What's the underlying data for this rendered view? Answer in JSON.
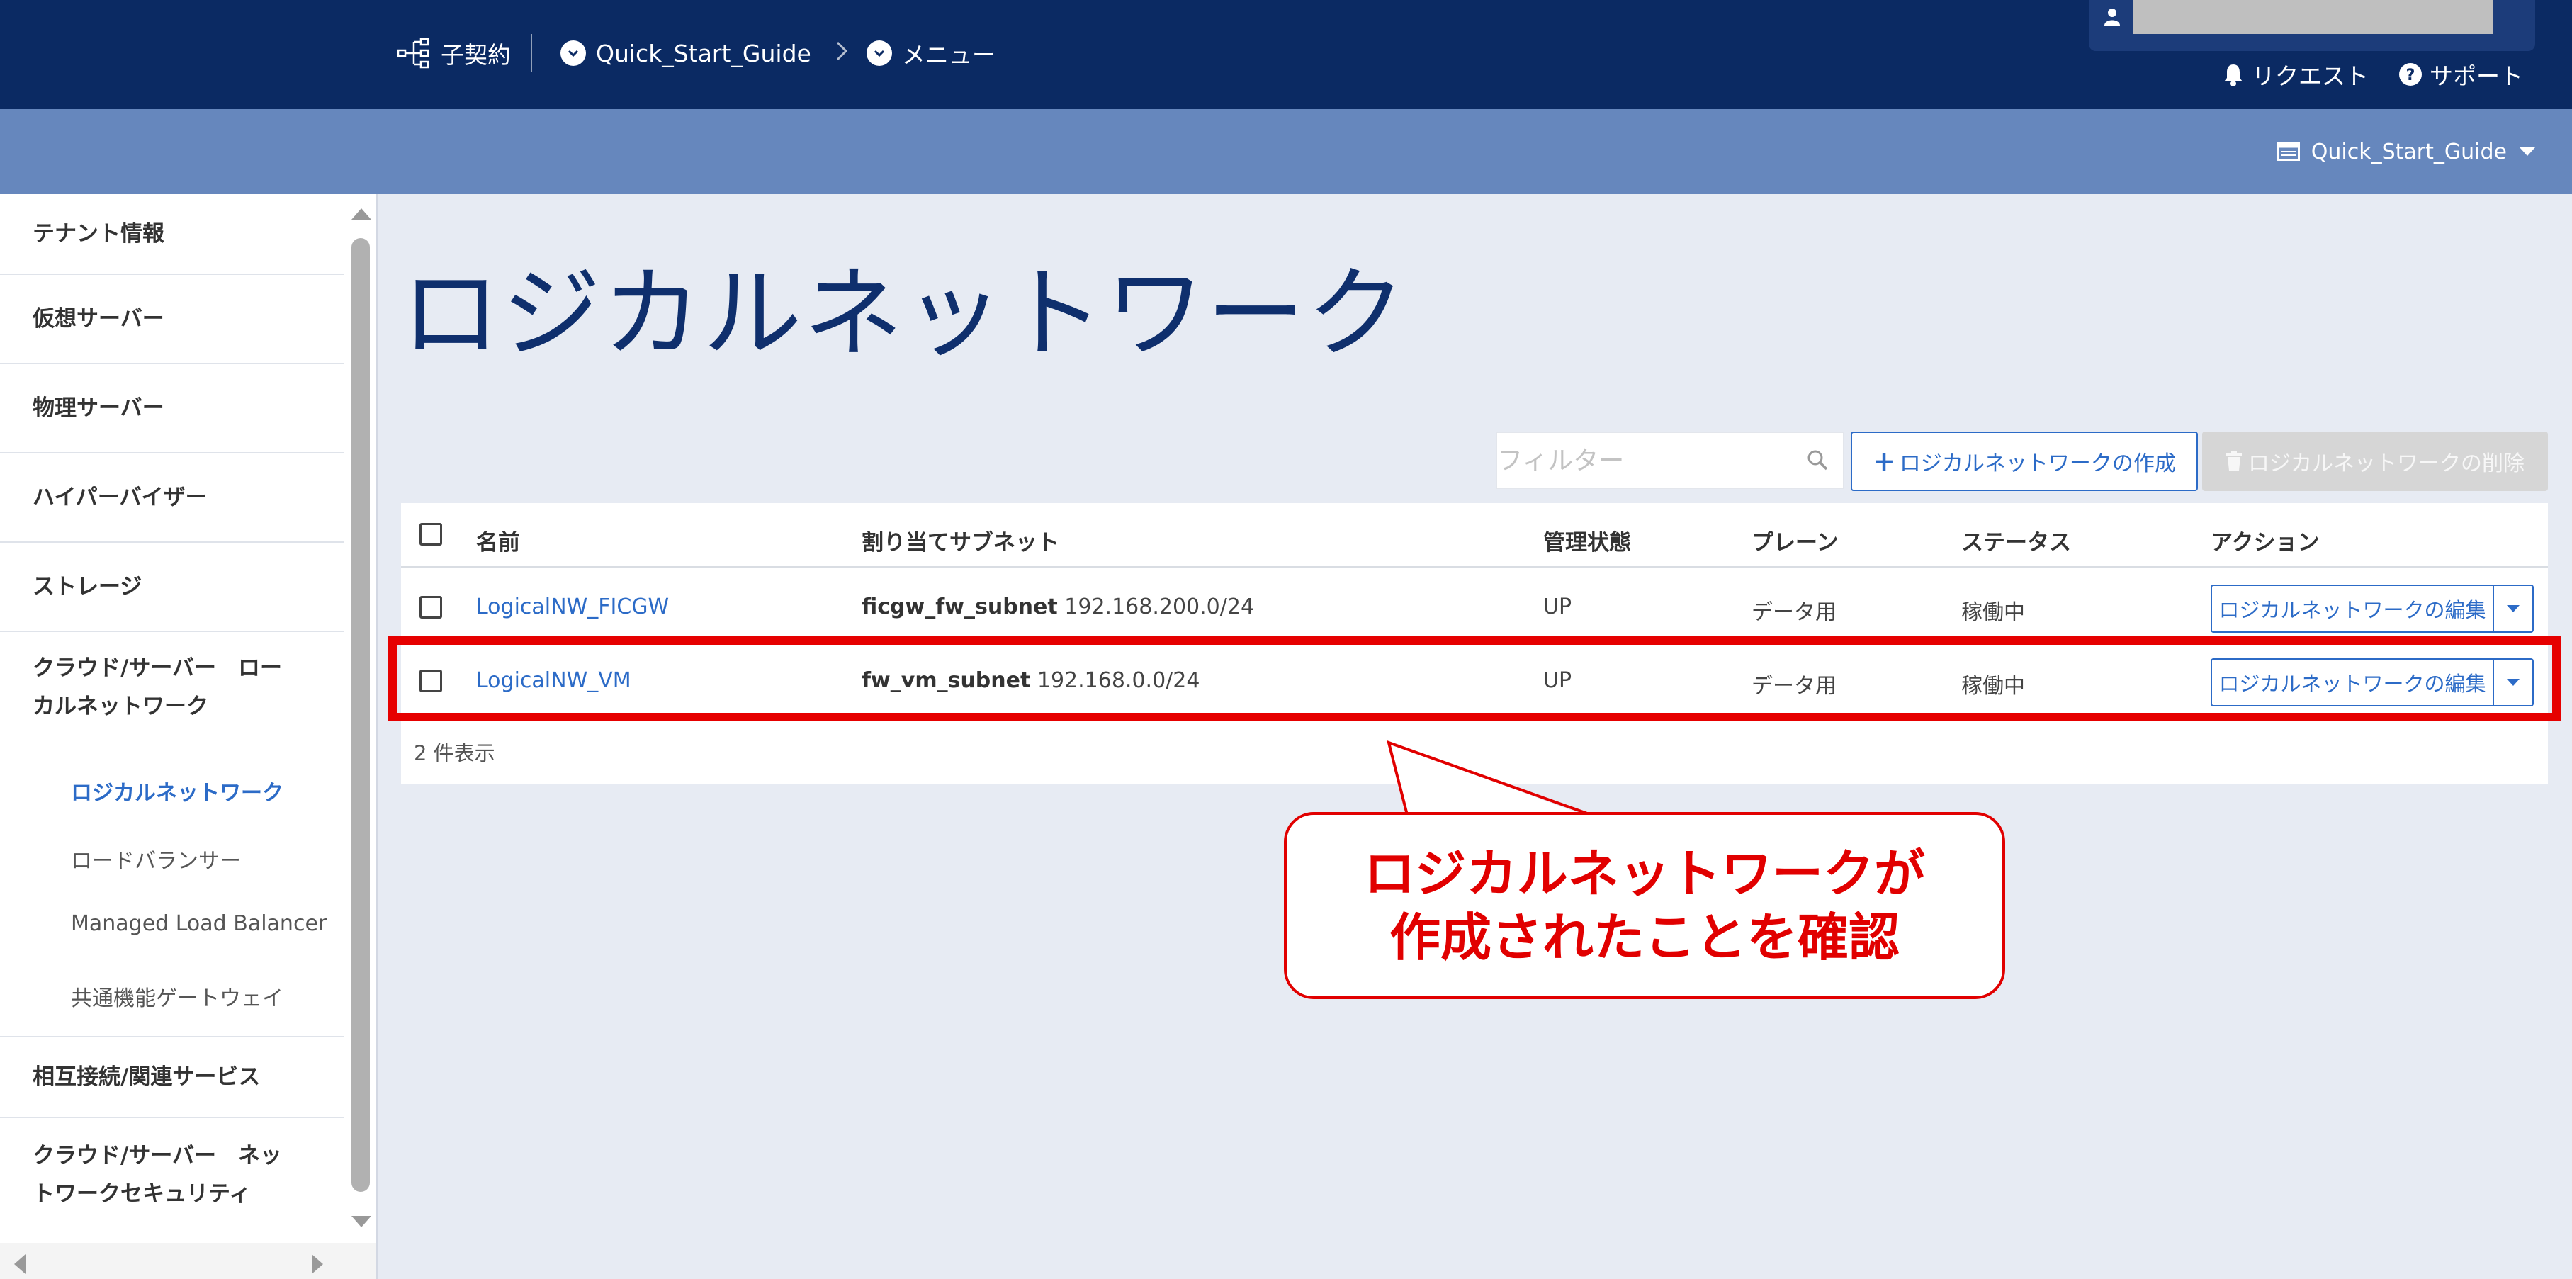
{
  "header": {
    "breadcrumbs": [
      {
        "label": "子契約",
        "icon": "org-tree-icon"
      },
      {
        "label": "Quick_Start_Guide",
        "icon": "chevron-circle-icon"
      },
      {
        "label": "メニュー",
        "icon": "chevron-circle-icon"
      }
    ],
    "links": [
      {
        "label": "リクエスト",
        "icon": "bell-icon"
      },
      {
        "label": "サポート",
        "icon": "question-circle-icon"
      }
    ],
    "user_icon": "user-icon"
  },
  "subheader": {
    "tenant_selector": "Quick_Start_Guide",
    "tenant_icon": "window-icon"
  },
  "sidebar": {
    "items": [
      "テナント情報",
      "仮想サーバー",
      "物理サーバー",
      "ハイパーバイザー",
      "ストレージ",
      "クラウド/サーバー　ローカルネットワーク",
      "相互接続/関連サービス",
      "クラウド/サーバー　ネットワークセキュリティ"
    ],
    "subitems": [
      "ロジカルネットワーク",
      "ロードバランサー",
      "Managed Load Balancer",
      "共通機能ゲートウェイ"
    ],
    "active_subitem": "ロジカルネットワーク"
  },
  "main": {
    "title": "ロジカルネットワーク",
    "filter_placeholder": "フィルター",
    "create_button": "ロジカルネットワークの作成",
    "delete_button": "ロジカルネットワークの削除",
    "table": {
      "columns": [
        "名前",
        "割り当てサブネット",
        "管理状態",
        "プレーン",
        "ステータス",
        "アクション"
      ],
      "rows": [
        {
          "name": "LogicalNW_FICGW",
          "subnet_name": "ficgw_fw_subnet",
          "subnet_cidr": "192.168.200.0/24",
          "admin_state": "UP",
          "plane": "データ用",
          "status": "稼働中",
          "action": "ロジカルネットワークの編集"
        },
        {
          "name": "LogicalNW_VM",
          "subnet_name": "fw_vm_subnet",
          "subnet_cidr": "192.168.0.0/24",
          "admin_state": "UP",
          "plane": "データ用",
          "status": "稼働中",
          "action": "ロジカルネットワークの編集"
        }
      ],
      "count_label": "2 件表示"
    }
  },
  "annotation": {
    "line1": "ロジカルネットワークが",
    "line2": "作成されたことを確認",
    "color": "#e10000"
  }
}
